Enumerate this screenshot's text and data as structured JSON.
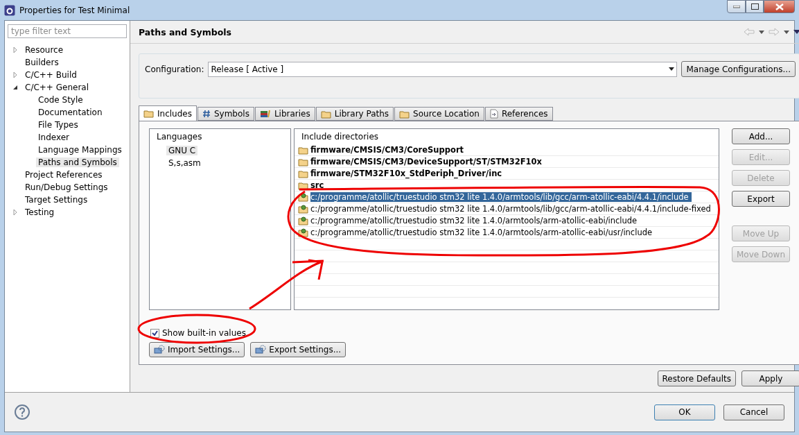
{
  "window": {
    "title": "Properties for Test Minimal"
  },
  "filter": {
    "placeholder": "type filter text"
  },
  "tree": [
    {
      "label": "Resource",
      "expanded": false,
      "selected": false
    },
    {
      "label": "Builders",
      "selected": false
    },
    {
      "label": "C/C++ Build",
      "expanded": false,
      "selected": false
    },
    {
      "label": "C/C++ General",
      "expanded": true,
      "selected": false,
      "children": [
        {
          "label": "Code Style",
          "selected": false
        },
        {
          "label": "Documentation",
          "selected": false
        },
        {
          "label": "File Types",
          "selected": false
        },
        {
          "label": "Indexer",
          "selected": false
        },
        {
          "label": "Language Mappings",
          "selected": false
        },
        {
          "label": "Paths and Symbols",
          "selected": true
        }
      ]
    },
    {
      "label": "Project References",
      "selected": false
    },
    {
      "label": "Run/Debug Settings",
      "selected": false
    },
    {
      "label": "Target Settings",
      "selected": false
    },
    {
      "label": "Testing",
      "expanded": false,
      "selected": false
    }
  ],
  "page": {
    "title": "Paths and Symbols"
  },
  "configuration": {
    "label": "Configuration:",
    "value": "Release  [ Active ]",
    "button": "Manage Configurations..."
  },
  "tabs": [
    {
      "label": "Includes",
      "selected": true
    },
    {
      "label": "Symbols",
      "selected": false
    },
    {
      "label": "Libraries",
      "selected": false
    },
    {
      "label": "Library Paths",
      "selected": false
    },
    {
      "label": "Source Location",
      "selected": false
    },
    {
      "label": "References",
      "selected": false
    }
  ],
  "languages": {
    "heading": "Languages",
    "items": [
      {
        "label": "GNU C",
        "selected": true
      },
      {
        "label": "S,s,asm",
        "selected": false
      }
    ]
  },
  "includes": {
    "heading": "Include directories",
    "rows": [
      {
        "path": "firmware/CMSIS/CM3/CoreSupport",
        "kind": "workspace",
        "selected": false
      },
      {
        "path": "firmware/CMSIS/CM3/DeviceSupport/ST/STM32F10x",
        "kind": "workspace",
        "selected": false
      },
      {
        "path": "firmware/STM32F10x_StdPeriph_Driver/inc",
        "kind": "workspace",
        "selected": false
      },
      {
        "path": "src",
        "kind": "workspace",
        "selected": false
      },
      {
        "path": "c:/programme/atollic/truestudio stm32 lite 1.4.0/armtools/lib/gcc/arm-atollic-eabi/4.4.1/include",
        "kind": "builtin",
        "selected": true
      },
      {
        "path": "c:/programme/atollic/truestudio stm32 lite 1.4.0/armtools/lib/gcc/arm-atollic-eabi/4.4.1/include-fixed",
        "kind": "builtin",
        "selected": false
      },
      {
        "path": "c:/programme/atollic/truestudio stm32 lite 1.4.0/armtools/arm-atollic-eabi/include",
        "kind": "builtin",
        "selected": false
      },
      {
        "path": "c:/programme/atollic/truestudio stm32 lite 1.4.0/armtools/arm-atollic-eabi/usr/include",
        "kind": "builtin",
        "selected": false
      }
    ]
  },
  "side_buttons": [
    {
      "label": "Add...",
      "disabled": false
    },
    {
      "label": "Edit...",
      "disabled": true
    },
    {
      "label": "Delete",
      "disabled": true
    },
    {
      "label": "Export",
      "disabled": false
    },
    {
      "label": "Move Up",
      "disabled": true
    },
    {
      "label": "Move Down",
      "disabled": true
    }
  ],
  "show_builtin": {
    "label": "Show built-in values",
    "checked": true
  },
  "settings_buttons": [
    "Import Settings...",
    "Export Settings..."
  ],
  "page_buttons": [
    "Restore Defaults",
    "Apply"
  ],
  "dialog_buttons": [
    "OK",
    "Cancel"
  ]
}
